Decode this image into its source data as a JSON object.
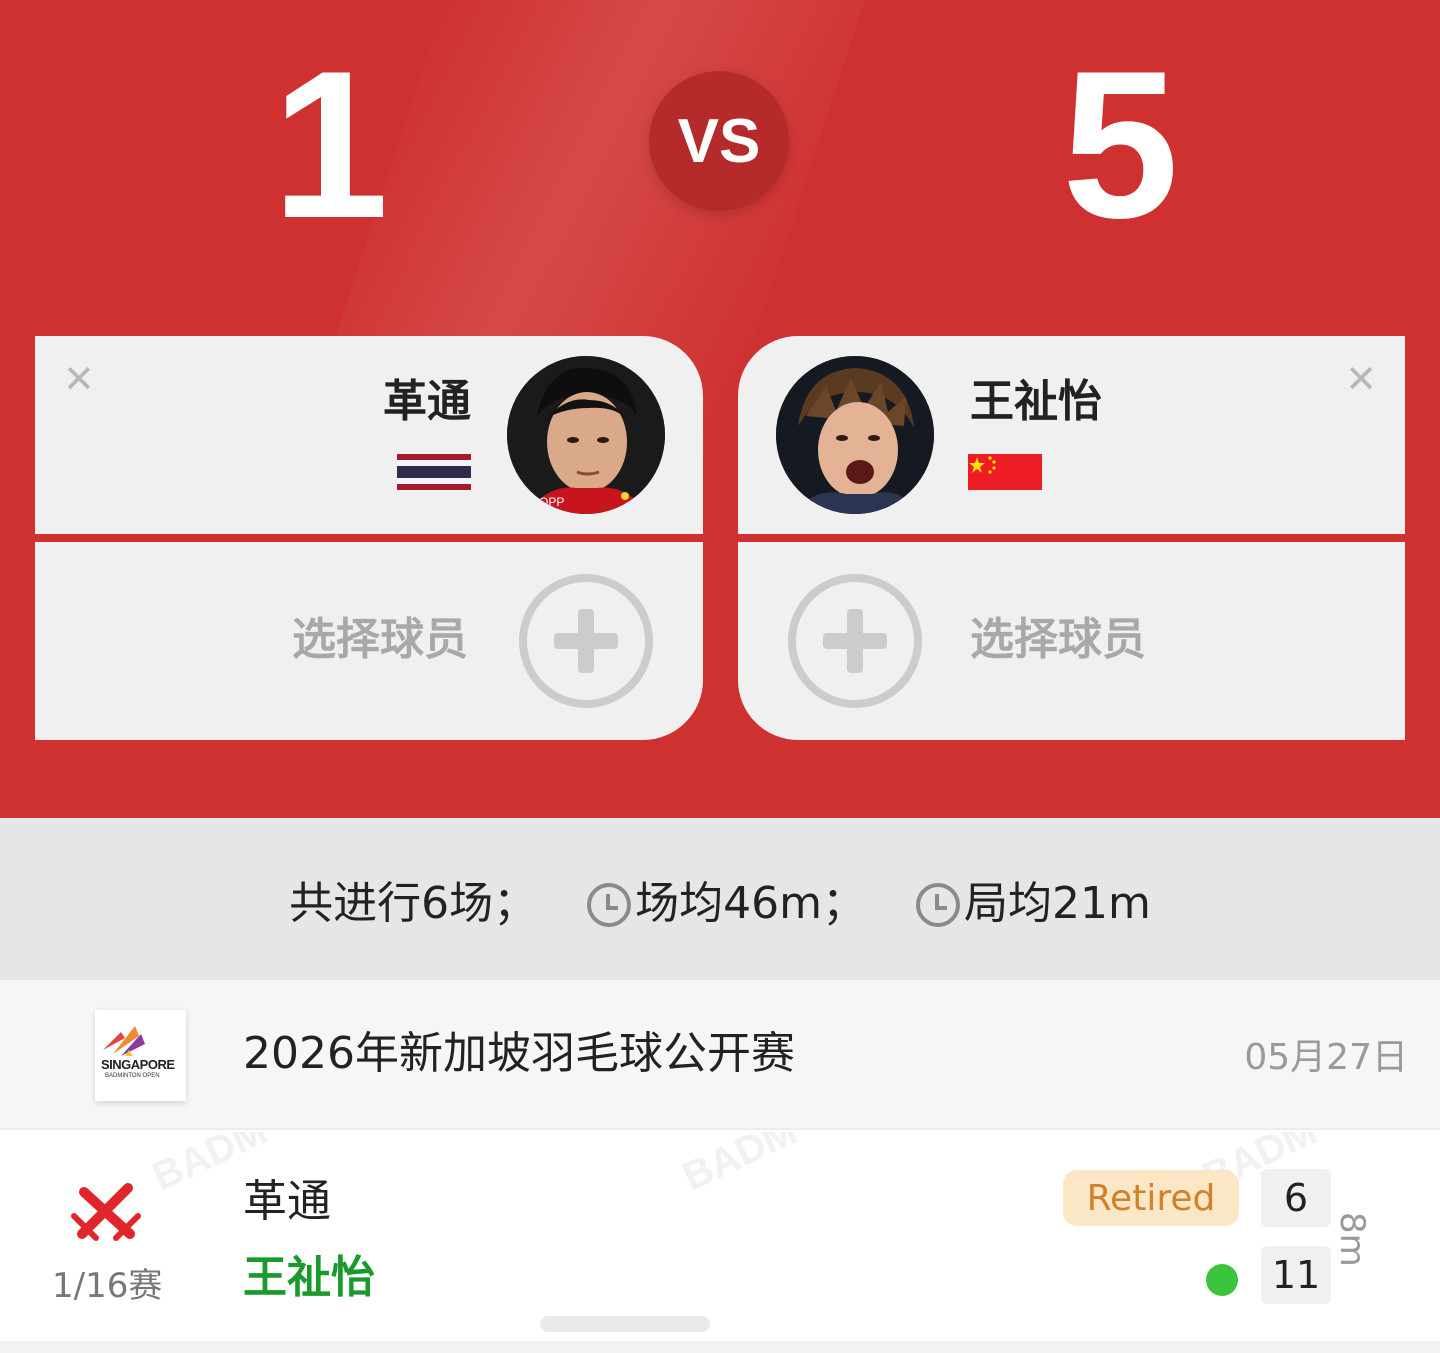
{
  "header": {
    "score_left": "1",
    "score_right": "5",
    "vs_label": "VS",
    "background_color": "#cf3030"
  },
  "players": {
    "left": {
      "name": "革通",
      "flag": "thailand-flag",
      "remove_icon": "close-icon",
      "select_label": "选择球员",
      "add_icon": "plus-circle-icon"
    },
    "right": {
      "name": "王祉怡",
      "flag": "china-flag",
      "remove_icon": "close-icon",
      "select_label": "选择球员",
      "add_icon": "plus-circle-icon"
    }
  },
  "summary": {
    "total": "共进行6场；",
    "avg_match": "场均46m；",
    "avg_game": "局均21m",
    "clock_icon": "clock-icon"
  },
  "tournament": {
    "logo_text": "SINGAPORE",
    "logo_sub": "BADMINTON OPEN",
    "name": "2026年新加坡羽毛球公开赛",
    "date": "05月27日"
  },
  "match": {
    "round": "1/16赛",
    "round_icon": "crossed-swords-icon",
    "player_a": "革通",
    "player_b": "王祉怡",
    "status": "Retired",
    "score_a": "6",
    "score_b": "11",
    "duration": "8m",
    "winner_color": "#1a9a2c"
  }
}
